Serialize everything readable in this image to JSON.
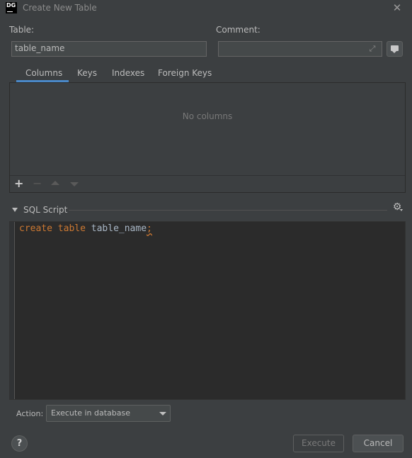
{
  "window": {
    "logo": "DG",
    "title": "Create New Table",
    "close_icon": "close-icon"
  },
  "form": {
    "table_label": "Table:",
    "table_value": "table_name",
    "comment_label": "Comment:",
    "comment_value": ""
  },
  "tabs": [
    {
      "label": "Columns",
      "selected": true
    },
    {
      "label": "Keys"
    },
    {
      "label": "Indexes"
    },
    {
      "label": "Foreign Keys"
    }
  ],
  "columns_panel": {
    "empty_text": "No columns",
    "toolbar": [
      "add-icon",
      "remove-icon",
      "move-up-icon",
      "move-down-icon"
    ]
  },
  "sql_script": {
    "label": "SQL Script",
    "code": {
      "kw1": "create",
      "kw2": "table",
      "name": "table_name",
      "end": ";"
    }
  },
  "action": {
    "label": "Action:",
    "selected": "Execute in database"
  },
  "buttons": {
    "help": "?",
    "execute": "Execute",
    "cancel": "Cancel"
  },
  "colors": {
    "background": "#3c3f41",
    "editor_bg": "#2b2b2b",
    "keyword": "#cc7832",
    "tab_accent": "#4a88c7"
  }
}
